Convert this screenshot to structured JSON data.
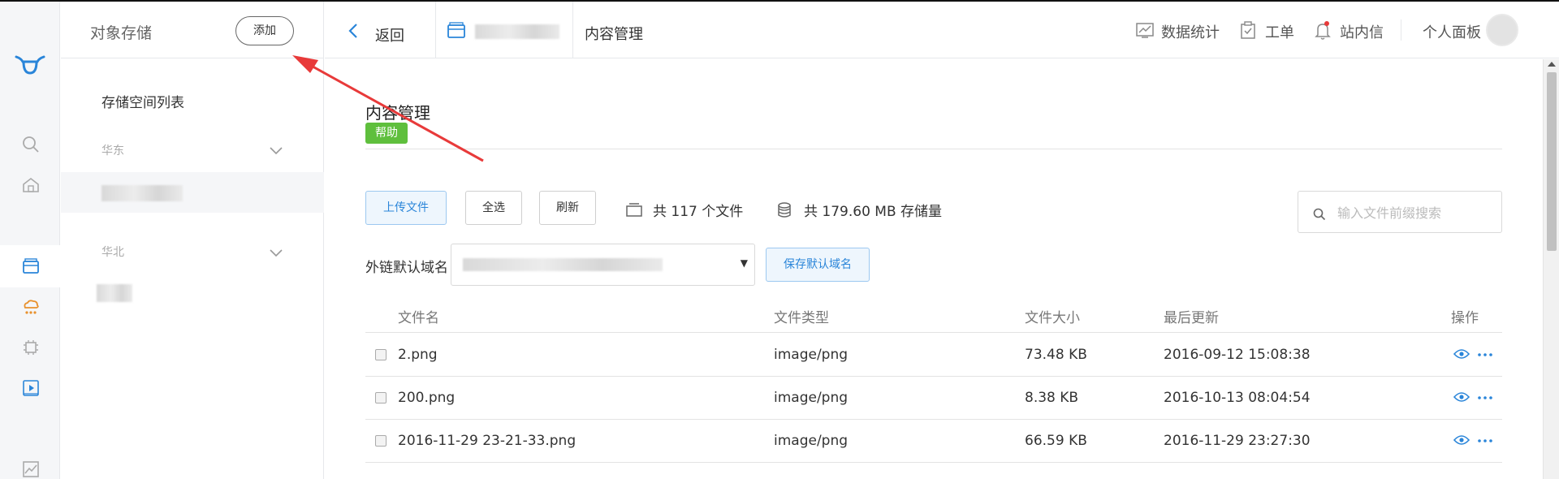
{
  "colors": {
    "accent": "#2a85d9",
    "help_green": "#5fbf3d",
    "arrow_red": "#e83a3a",
    "orange": "#e8912d"
  },
  "rail": {
    "icons": [
      "logo-icon",
      "search-icon",
      "home-icon",
      "storage-icon",
      "cdn-cloud-icon",
      "chip-icon",
      "video-icon",
      "chart-icon"
    ]
  },
  "sidebar": {
    "title": "对象存储",
    "add_button": "添加",
    "subtitle": "存储空间列表",
    "regions": [
      {
        "name": "华东"
      },
      {
        "name": "华北"
      }
    ]
  },
  "header": {
    "back": "返回",
    "crumb": "内容管理",
    "nav": [
      {
        "label": "数据统计",
        "icon": "stats-icon"
      },
      {
        "label": "工单",
        "icon": "ticket-icon"
      },
      {
        "label": "站内信",
        "icon": "bell-icon"
      },
      {
        "label": "个人面板",
        "icon": "avatar"
      }
    ]
  },
  "main": {
    "title": "内容管理",
    "help": "帮助",
    "toolbar": {
      "upload": "上传文件",
      "select_all": "全选",
      "refresh": "刷新",
      "file_count": "共 117 个文件",
      "storage": "共 179.60 MB 存储量"
    },
    "search": {
      "placeholder": "输入文件前缀搜索",
      "value": ""
    },
    "domain": {
      "label": "外链默认域名",
      "save": "保存默认域名"
    },
    "table": {
      "columns": [
        "文件名",
        "文件类型",
        "文件大小",
        "最后更新",
        "操作"
      ],
      "rows": [
        {
          "name": "2.png",
          "type": "image/png",
          "size": "73.48 KB",
          "updated": "2016-09-12 15:08:38"
        },
        {
          "name": "200.png",
          "type": "image/png",
          "size": "8.38 KB",
          "updated": "2016-10-13 08:04:54"
        },
        {
          "name": "2016-11-29 23-21-33.png",
          "type": "image/png",
          "size": "66.59 KB",
          "updated": "2016-11-29 23:27:30"
        }
      ]
    }
  }
}
